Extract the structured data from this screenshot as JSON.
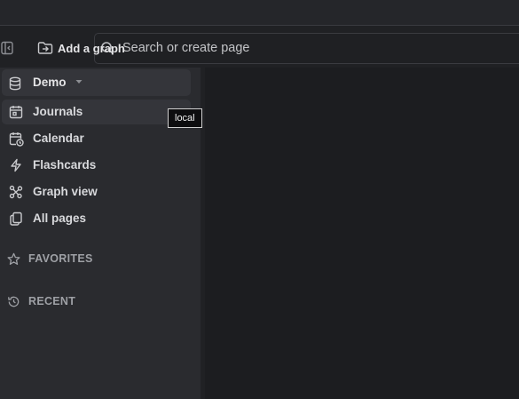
{
  "header": {
    "add_graph_label": "Add a graph",
    "search_placeholder": "Search or create page"
  },
  "sidebar": {
    "graph_name": "Demo",
    "graph_tooltip": "local",
    "nav_items": [
      {
        "label": "Journals",
        "icon": "calendar-day-icon",
        "active": true
      },
      {
        "label": "Calendar",
        "icon": "calendar-clock-icon",
        "active": false
      },
      {
        "label": "Flashcards",
        "icon": "bolt-icon",
        "active": false
      },
      {
        "label": "Graph view",
        "icon": "graph-nodes-icon",
        "active": false
      },
      {
        "label": "All pages",
        "icon": "pages-icon",
        "active": false
      }
    ],
    "sections": [
      {
        "label": "FAVORITES",
        "icon": "star-icon"
      },
      {
        "label": "RECENT",
        "icon": "history-icon"
      }
    ]
  },
  "colors": {
    "background": "#202124",
    "sidebar": "#2a2b2f",
    "active_item": "#34353a",
    "text": "#d8d9dc",
    "muted_text": "#9ea0a5"
  }
}
